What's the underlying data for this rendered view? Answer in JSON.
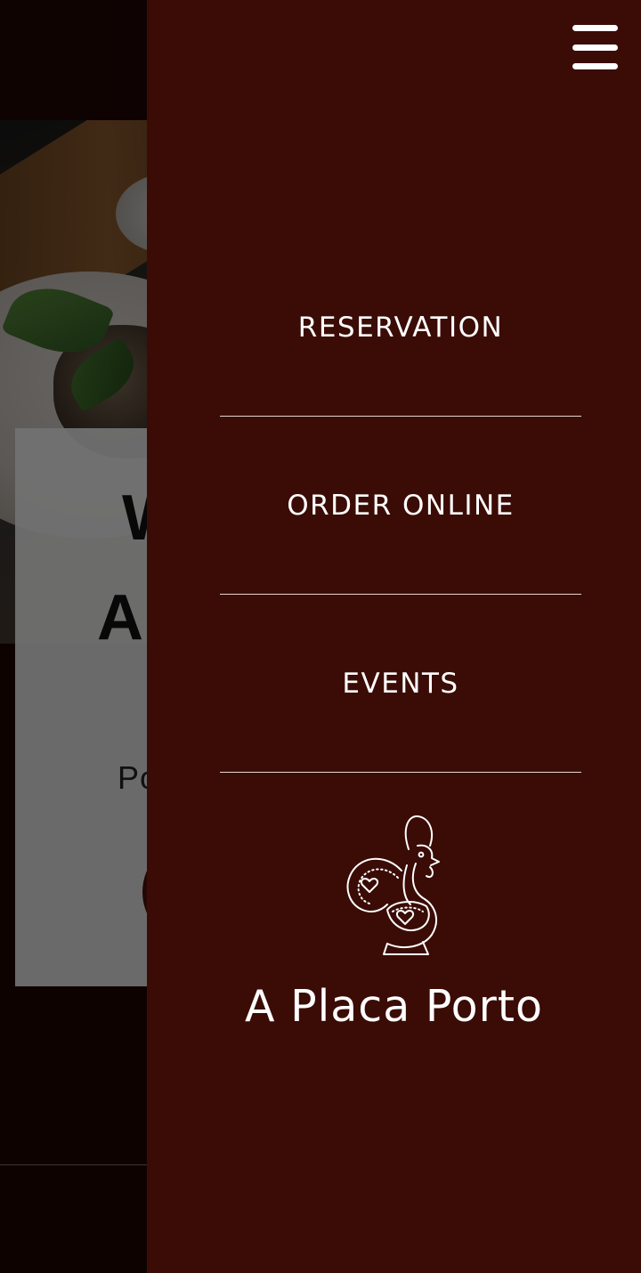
{
  "background": {
    "card_line1": "W",
    "card_line2": "A",
    "card_sub": "Po"
  },
  "drawer": {
    "nav_items": [
      {
        "label": "RESERVATION"
      },
      {
        "label": "ORDER ONLINE"
      },
      {
        "label": "EVENTS"
      }
    ],
    "brand_name": "A Placa Porto"
  },
  "icons": {
    "menu": "hamburger-menu-icon",
    "logo": "rooster-logo-icon"
  },
  "colors": {
    "drawer_bg": "#3b0c06",
    "page_bg": "#1e0503",
    "text": "#ffffff",
    "divider": "#e6d5d1"
  }
}
